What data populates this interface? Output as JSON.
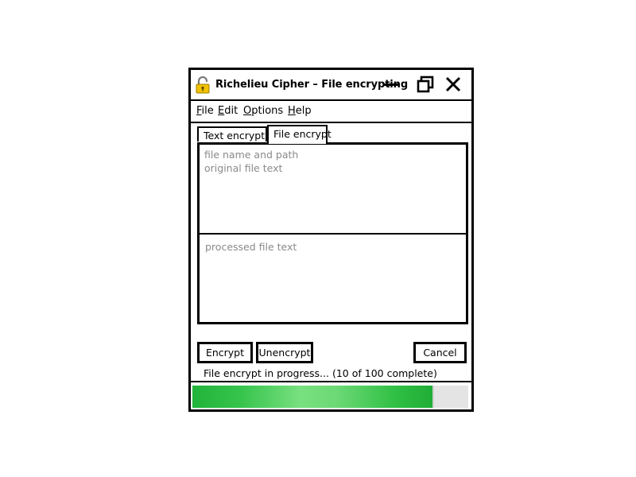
{
  "window": {
    "title": "Richelieu Cipher – File encrypting",
    "icon": "lock-open-icon",
    "controls": [
      "minimize-icon",
      "restore-icon",
      "close-icon"
    ]
  },
  "menu": [
    "File",
    "Edit",
    "Options",
    "Help"
  ],
  "tabs": {
    "text": "Text encrypt",
    "file": "File encrypt",
    "active": "file"
  },
  "input": {
    "file_path_placeholder": "file name and path",
    "original_text_placeholder": "original file text"
  },
  "output": {
    "processed_text_placeholder": "processed file text"
  },
  "buttons": {
    "encrypt": "Encrypt",
    "unencrypt": "Unencrypt",
    "cancel": "Cancel"
  },
  "status": {
    "text": "File encrypt in progress...",
    "detail": "(10 of 100 complete)"
  },
  "progress": {
    "fraction": 0.87
  },
  "colors": {
    "progress": "#2fbf44",
    "lock": "#f2c200"
  }
}
